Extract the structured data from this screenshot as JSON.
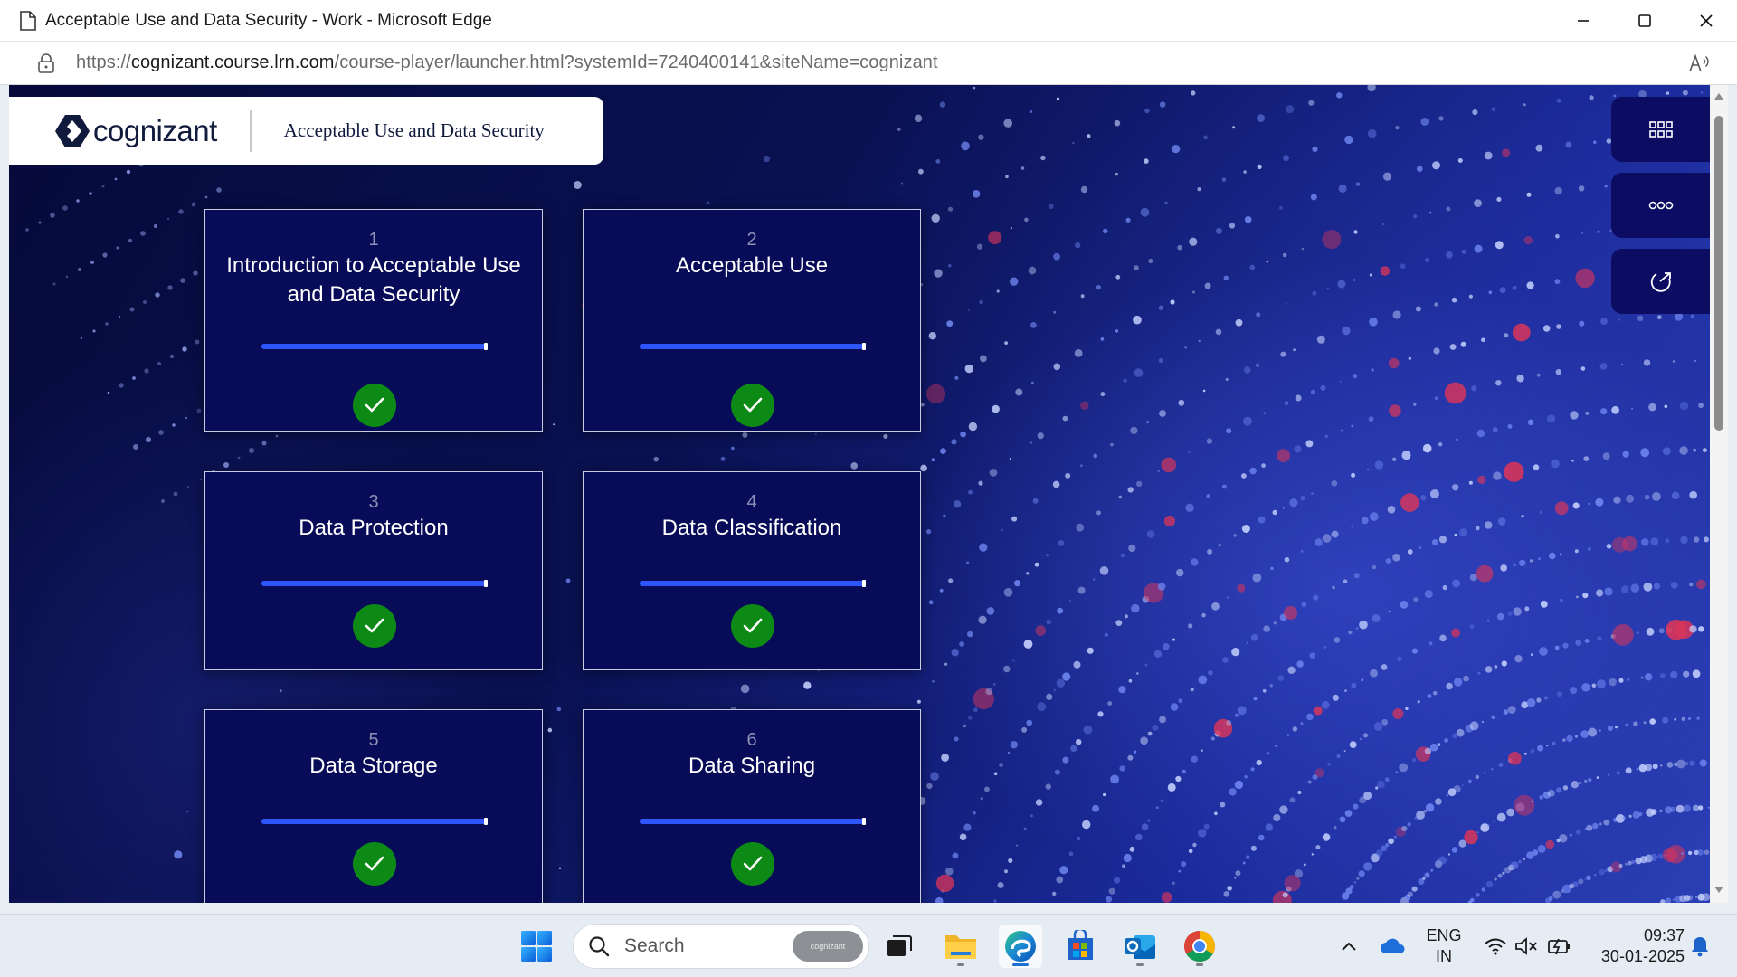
{
  "window": {
    "title": "Acceptable Use and Data Security - Work - Microsoft Edge"
  },
  "address_bar": {
    "url_prefix": "https://",
    "url_host": "cognizant.course.lrn.com",
    "url_rest": "/course-player/launcher.html?systemId=7240400141&siteName=cognizant"
  },
  "brand": {
    "logo_text": "cognizant",
    "course_title": "Acceptable Use and Data Security"
  },
  "modules": [
    {
      "number": "1",
      "title": "Introduction to Acceptable Use and Data Security",
      "progress": 1.0,
      "completed": true
    },
    {
      "number": "2",
      "title": "Acceptable Use",
      "progress": 1.0,
      "completed": true
    },
    {
      "number": "3",
      "title": "Data Protection",
      "progress": 1.0,
      "completed": true
    },
    {
      "number": "4",
      "title": "Data Classification",
      "progress": 1.0,
      "completed": true
    },
    {
      "number": "5",
      "title": "Data Storage",
      "progress": 1.0,
      "completed": true
    },
    {
      "number": "6",
      "title": "Data Sharing",
      "progress": 1.0,
      "completed": true
    }
  ],
  "side_menu": [
    {
      "icon": "grid-menu-icon"
    },
    {
      "icon": "more-options-icon"
    },
    {
      "icon": "exit-icon"
    }
  ],
  "taskbar": {
    "search_placeholder": "Search",
    "search_pill": "cognizant",
    "apps": [
      "windows-start-icon",
      "file-explorer-icon",
      "edge-icon",
      "microsoft-store-icon",
      "outlook-icon",
      "chrome-icon"
    ],
    "lang_line1": "ENG",
    "lang_line2": "IN",
    "time": "09:37",
    "date": "30-01-2025"
  },
  "colors": {
    "card_bg": "#080b57",
    "progress": "#2f55ff",
    "check": "#0c8a15",
    "brand_text": "#0f1a3c"
  }
}
